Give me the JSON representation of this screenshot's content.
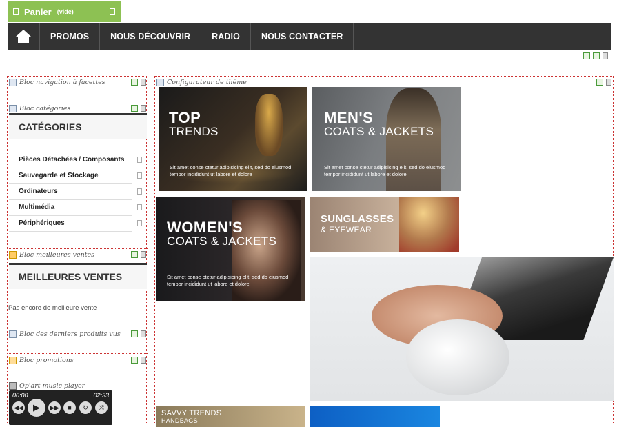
{
  "cart": {
    "title": "Panier",
    "status": "(vide)"
  },
  "nav": {
    "items": [
      "PROMOS",
      "NOUS DÉCOUVRIR",
      "RADIO",
      "NOUS CONTACTER"
    ]
  },
  "left": {
    "facets_label": "Bloc navigation à facettes",
    "categories_label": "Bloc catégories",
    "categories_title": "CATÉGORIES",
    "categories": [
      "Pièces Détachées / Composants",
      "Sauvegarde et Stockage",
      "Ordinateurs",
      "Multimédia",
      "Périphériques"
    ],
    "bestsellers_label": "Bloc meilleures ventes",
    "bestsellers_title": "MEILLEURES VENTES",
    "bestsellers_empty": "Pas encore de meilleure vente",
    "viewed_label": "Bloc des derniers produits vus",
    "promotions_label": "Bloc promotions",
    "player_label": "Op'art music player",
    "player_time_left": "00:00",
    "player_time_right": "02:33"
  },
  "right": {
    "configurator_label": "Configurateur de thème",
    "tiles": [
      {
        "h1": "TOP",
        "h2": "TRENDS",
        "desc": "Sit amet conse ctetur adipisicing elit, sed do eiusmod tempor incididunt ut labore et dolore"
      },
      {
        "h1": "MEN'S",
        "h2": "COATS & JACKETS",
        "desc": "Sit amet conse ctetur adipisicing elit, sed do eiusmod tempor incididunt ut labore et dolore"
      },
      {
        "h1": "WOMEN'S",
        "h2": "COATS & JACKETS",
        "desc": "Sit amet conse ctetur adipisicing elit, sed do eiusmod tempor incididunt ut labore et dolore"
      },
      {
        "h1": "SUNGLASSES",
        "h2": "& EYEWEAR"
      },
      {
        "h1": "SAVVY TRENDS",
        "h2": "HANDBAGS"
      }
    ]
  },
  "colors": {
    "cart": "#8dc153",
    "nav": "#333333",
    "block_border": "#cc3333"
  }
}
